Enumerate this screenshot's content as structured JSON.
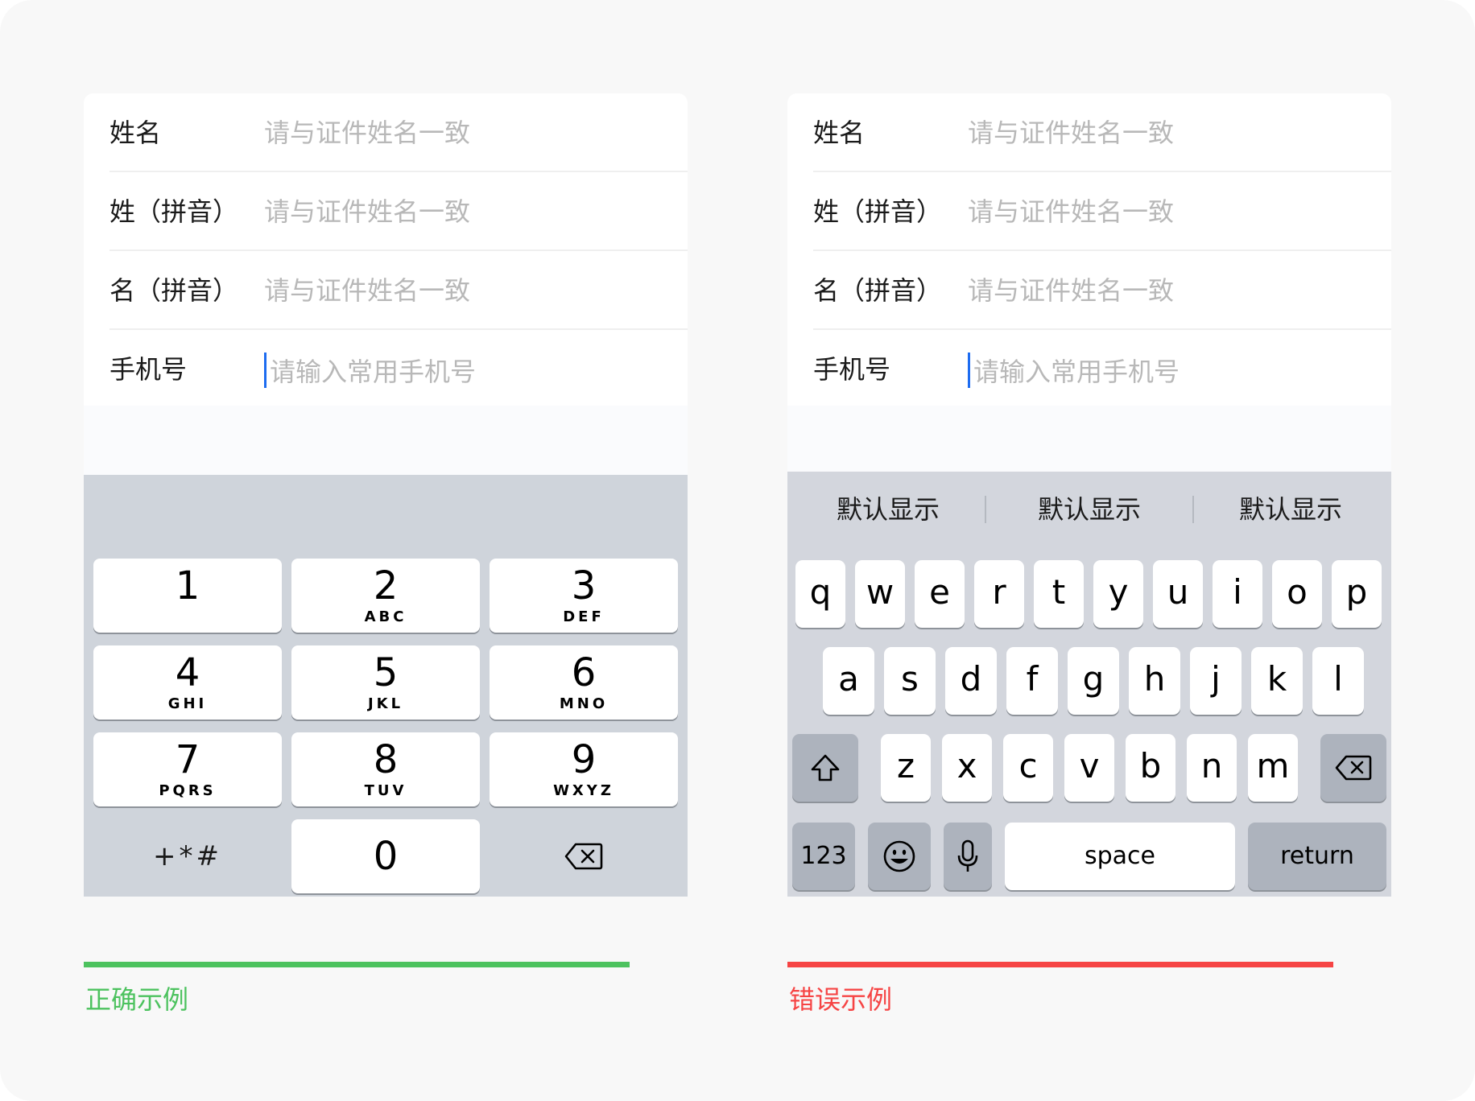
{
  "form": {
    "rows": [
      {
        "label": "姓名",
        "placeholder": "请与证件姓名一致"
      },
      {
        "label": "姓（拼音）",
        "placeholder": "请与证件姓名一致"
      },
      {
        "label": "名（拼音）",
        "placeholder": "请与证件姓名一致"
      },
      {
        "label": "手机号",
        "placeholder": "请输入常用手机号"
      }
    ]
  },
  "numpad": {
    "keys": [
      {
        "digit": "1",
        "letters": ""
      },
      {
        "digit": "2",
        "letters": "ABC"
      },
      {
        "digit": "3",
        "letters": "DEF"
      },
      {
        "digit": "4",
        "letters": "GHI"
      },
      {
        "digit": "5",
        "letters": "JKL"
      },
      {
        "digit": "6",
        "letters": "MNO"
      },
      {
        "digit": "7",
        "letters": "PQRS"
      },
      {
        "digit": "8",
        "letters": "TUV"
      },
      {
        "digit": "9",
        "letters": "WXYZ"
      }
    ],
    "symbols": "+*#",
    "zero": "0",
    "delete_icon": "backspace-icon"
  },
  "keyboard": {
    "suggestions": [
      "默认显示",
      "默认显示",
      "默认显示"
    ],
    "row1": [
      "q",
      "w",
      "e",
      "r",
      "t",
      "y",
      "u",
      "i",
      "o",
      "p"
    ],
    "row2": [
      "a",
      "s",
      "d",
      "f",
      "g",
      "h",
      "j",
      "k",
      "l"
    ],
    "row3": [
      "z",
      "x",
      "c",
      "v",
      "b",
      "n",
      "m"
    ],
    "numbers_key": "123",
    "space_key": "space",
    "return_key": "return",
    "shift_icon": "shift-icon",
    "delete_icon": "backspace-icon",
    "emoji_icon": "emoji-icon",
    "mic_icon": "microphone-icon"
  },
  "captions": {
    "good": "正确示例",
    "bad": "错误示例"
  },
  "colors": {
    "good": "#4cc25e",
    "bad": "#f64444",
    "caret": "#1d6cf0",
    "keyboard_bg": "#cfd4db"
  }
}
